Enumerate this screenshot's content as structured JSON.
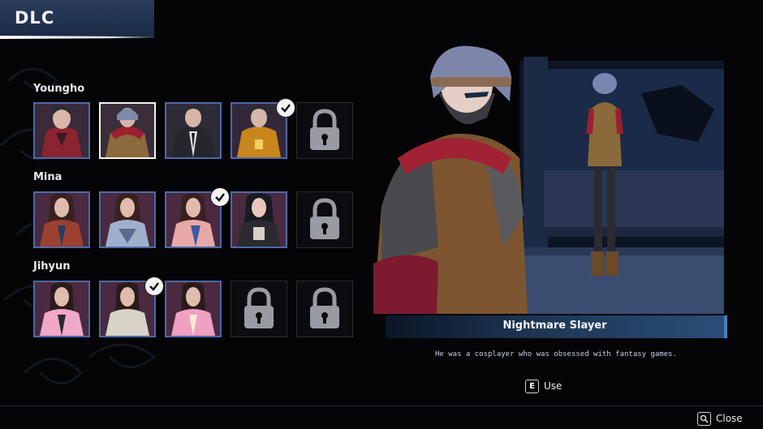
{
  "header": {
    "title": "DLC"
  },
  "characters": [
    {
      "name": "Youngho"
    },
    {
      "name": "Mina"
    },
    {
      "name": "Jihyun"
    }
  ],
  "preview": {
    "outfit_name": "Nightmare Slayer",
    "description": "He was a cosplayer who was obsessed with fantasy games."
  },
  "actions": {
    "use_key": "E",
    "use_label": "Use",
    "close_label": "Close"
  },
  "colors": {
    "slot_border": "#4a6aa8",
    "selected_border": "#f2f2f2",
    "banner_accent": "#4a7fbd"
  },
  "icons": [
    "lock-icon",
    "checkmark-icon",
    "search-key-icon"
  ]
}
